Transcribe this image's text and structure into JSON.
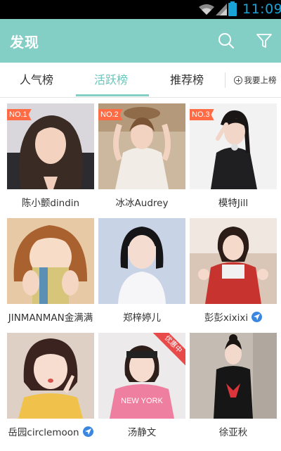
{
  "status_bar": {
    "time": "11:09"
  },
  "header": {
    "title": "发现"
  },
  "tabs": [
    {
      "label": "人气榜",
      "active": false
    },
    {
      "label": "活跃榜",
      "active": true
    },
    {
      "label": "推荐榜",
      "active": false
    }
  ],
  "upload_label": "我要上榜",
  "cards": [
    {
      "name": "陈小颤dindin",
      "rank": "NO.1"
    },
    {
      "name": "冰冰Audrey",
      "rank": "NO.2"
    },
    {
      "name": "模特Jill",
      "rank": "NO.3"
    },
    {
      "name": "JINMANMAN金满满"
    },
    {
      "name": "郑梓婷儿"
    },
    {
      "name": "彭彭xixixi",
      "verified": true
    },
    {
      "name": "岳园circlemoon",
      "verified": true
    },
    {
      "name": "汤静文",
      "ribbon": "优惠中",
      "shirt_text": "NEW YORK"
    },
    {
      "name": "徐亚秋"
    }
  ],
  "colors": {
    "accent": "#83cfc6",
    "active_tab": "#6cc6bb",
    "rank_badge": "#ff6b45",
    "verified": "#3b86e0",
    "ribbon": "#e84a4a"
  }
}
